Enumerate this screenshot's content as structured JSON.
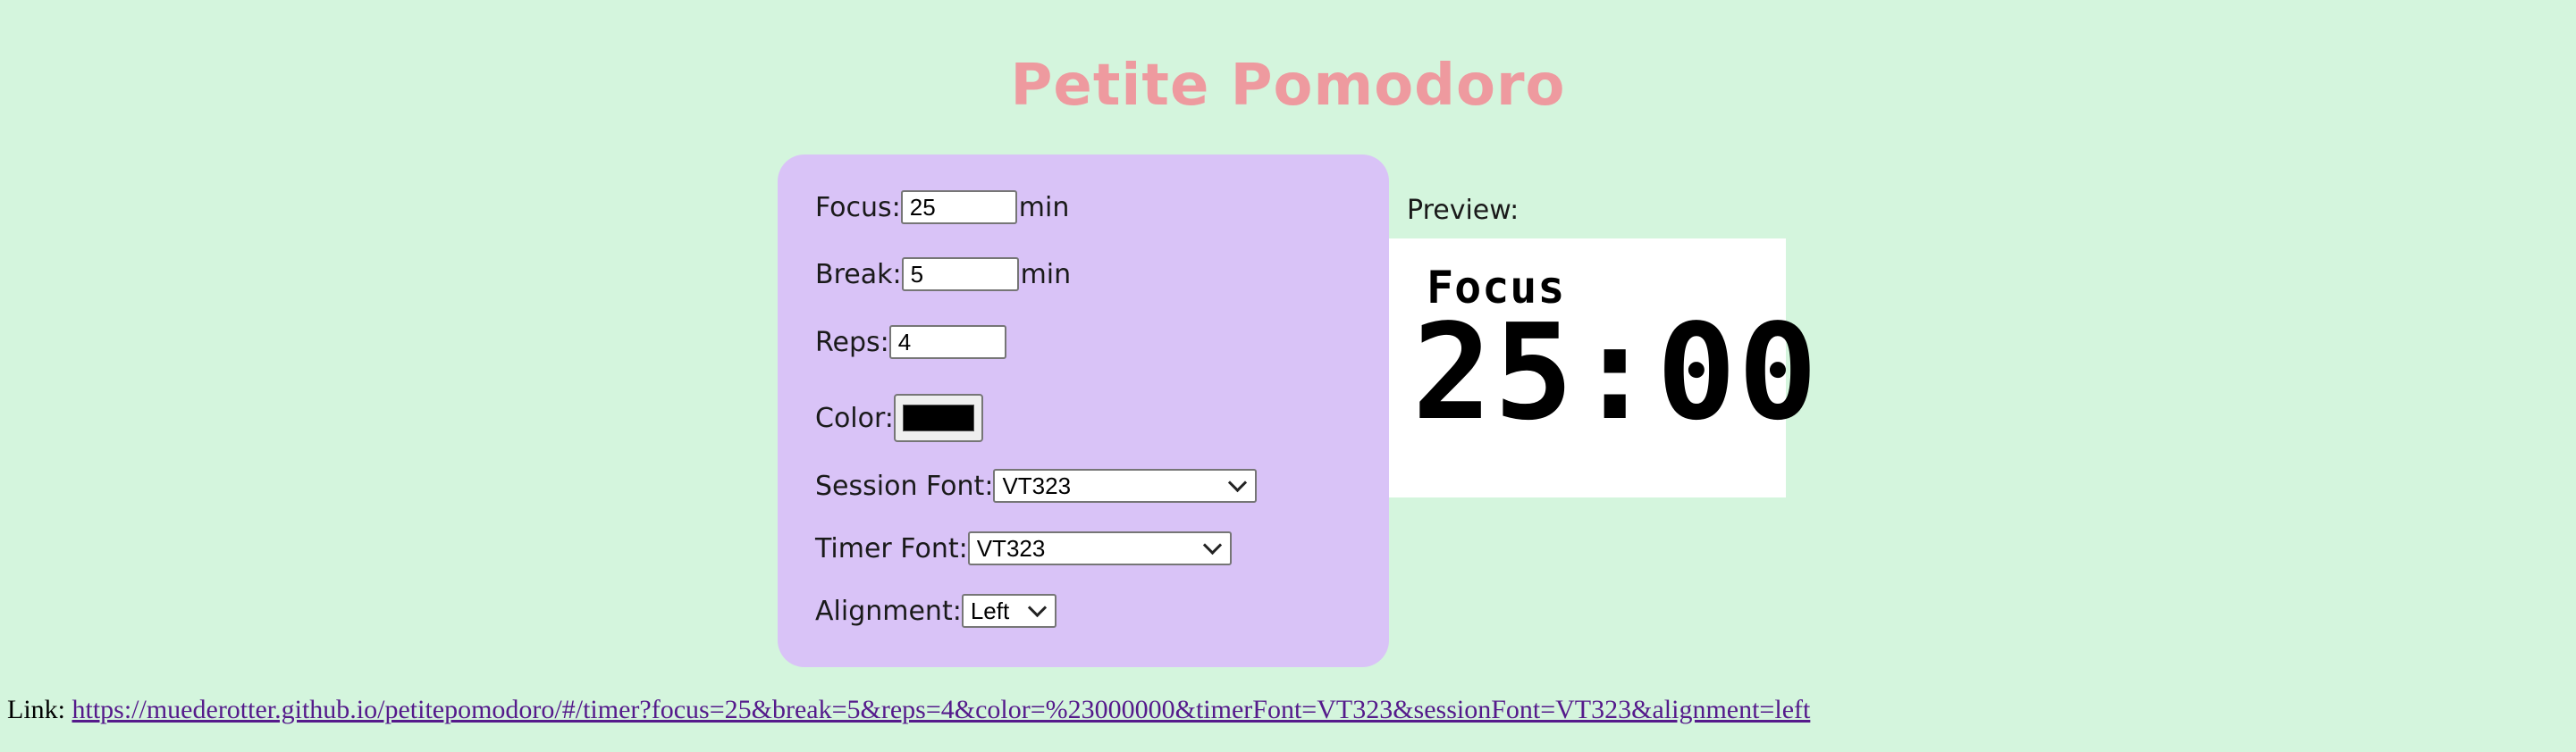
{
  "app": {
    "title": "Petite Pomodoro"
  },
  "form": {
    "focus": {
      "label": "Focus:",
      "value": "25",
      "unit": "min"
    },
    "break": {
      "label": "Break:",
      "value": "5",
      "unit": "min"
    },
    "reps": {
      "label": "Reps:",
      "value": "4"
    },
    "color": {
      "label": "Color:",
      "value": "#000000"
    },
    "session_font": {
      "label": "Session Font:",
      "selected": "VT323"
    },
    "timer_font": {
      "label": "Timer Font:",
      "selected": "VT323"
    },
    "alignment": {
      "label": "Alignment:",
      "selected": "Left"
    }
  },
  "preview": {
    "label": "Preview:",
    "session_text": "Focus",
    "timer_text": "25:00"
  },
  "link": {
    "label": "Link:",
    "url": "https://muederotter.github.io/petitepomodoro/#/timer?focus=25&break=5&reps=4&color=%23000000&timerFont=VT323&sessionFont=VT323&alignment=left"
  },
  "colors": {
    "background": "#d4f5dd",
    "panel": "#d9c3f7",
    "title": "#ee9a9f",
    "swatch": "#000000"
  },
  "icons": {
    "select_chevron": "chevron-down-icon"
  }
}
